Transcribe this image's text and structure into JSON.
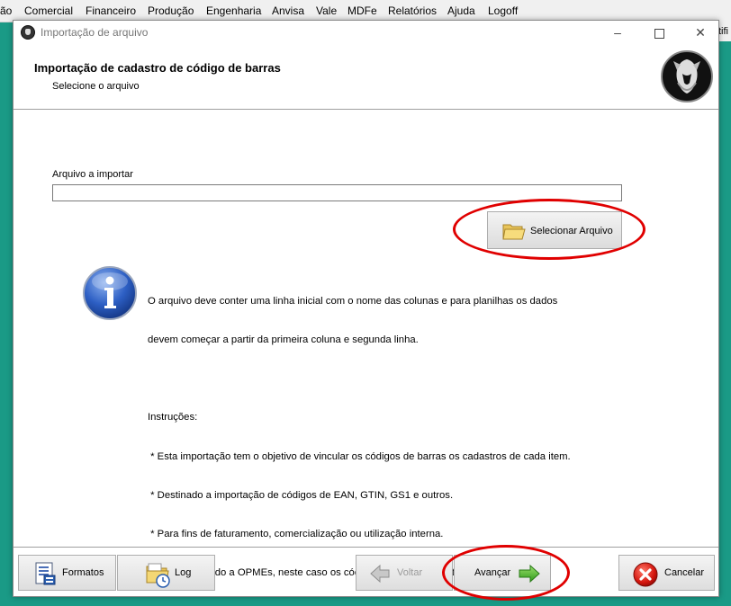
{
  "menubar": {
    "items": [
      "ão",
      "Comercial",
      "Financeiro",
      "Produção",
      "Engenharia",
      "Anvisa",
      "Vale",
      "MDFe",
      "Relatórios",
      "Ajuda",
      "Logoff"
    ],
    "right_stub": "tifi"
  },
  "dialog": {
    "title": "Importação de arquivo",
    "header_title": "Importação de cadastro de código de barras",
    "header_subtitle": "Selecione o arquivo"
  },
  "file": {
    "label": "Arquivo a importar",
    "value": "",
    "select_button_label": "Selecionar Arquivo"
  },
  "info": {
    "lines": [
      "O arquivo deve conter uma linha inicial com o nome das colunas e para planilhas os dados",
      "devem começar a partir da primeira coluna e segunda linha.",
      "",
      "Instruções:",
      " * Esta importação tem o objetivo de vincular os códigos de barras os cadastros de cada item.",
      " * Destinado a importação de códigos de EAN, GTIN, GS1 e outros.",
      " * Para fins de faturamento, comercialização ou utilização interna.",
      " * NÃO destinado a OPMEs, neste caso os códigos são gerados automaticamente."
    ]
  },
  "footer": {
    "formatos": "Formatos",
    "log": "Log",
    "voltar": "Voltar",
    "avancar": "Avançar",
    "cancelar": "Cancelar"
  },
  "colors": {
    "desktop": "#1a9a86",
    "annotation": "#e00000"
  }
}
